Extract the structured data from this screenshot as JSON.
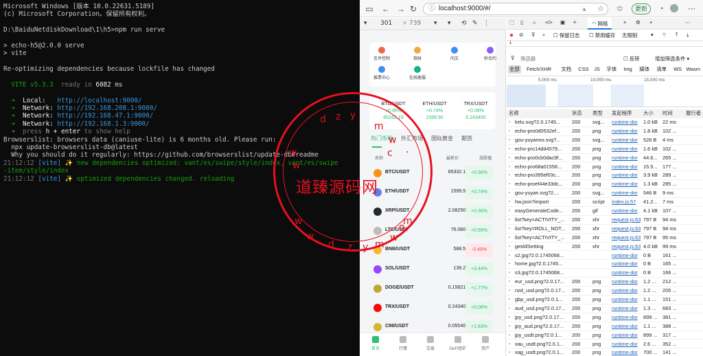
{
  "terminal": {
    "lines": [
      {
        "parts": [
          {
            "t": "Microsoft Windows [版本 10.0.22631.5189]",
            "c": ""
          }
        ]
      },
      {
        "parts": [
          {
            "t": "(c) Microsoft Corporation。保留所有权利。",
            "c": ""
          }
        ]
      },
      {
        "parts": [
          {
            "t": "",
            "c": ""
          }
        ]
      },
      {
        "parts": [
          {
            "t": "D:\\BaiduNetdiskDownload\\1\\h5>npm run serve",
            "c": ""
          }
        ]
      },
      {
        "parts": [
          {
            "t": "",
            "c": ""
          }
        ]
      },
      {
        "parts": [
          {
            "t": "> echo-h5@2.0.0 serve",
            "c": ""
          }
        ]
      },
      {
        "parts": [
          {
            "t": "> vite",
            "c": ""
          }
        ]
      },
      {
        "parts": [
          {
            "t": "",
            "c": ""
          }
        ]
      },
      {
        "parts": [
          {
            "t": "Re-optimizing dependencies because lockfile has changed",
            "c": ""
          }
        ]
      },
      {
        "parts": [
          {
            "t": "",
            "c": ""
          }
        ]
      },
      {
        "parts": [
          {
            "t": "  VITE v5.3.3",
            "c": "g"
          },
          {
            "t": "  ready in ",
            "c": "gr"
          },
          {
            "t": "6082",
            "c": "w"
          },
          {
            "t": " ms",
            "c": ""
          }
        ]
      },
      {
        "parts": [
          {
            "t": "",
            "c": ""
          }
        ]
      },
      {
        "parts": [
          {
            "t": "  ➜  ",
            "c": "g"
          },
          {
            "t": "Local:   ",
            "c": "w"
          },
          {
            "t": "http://localhost:9000/",
            "c": "c"
          }
        ]
      },
      {
        "parts": [
          {
            "t": "  ➜  ",
            "c": "g"
          },
          {
            "t": "Network: ",
            "c": "w"
          },
          {
            "t": "http://192.168.208.1:9000/",
            "c": "c"
          }
        ]
      },
      {
        "parts": [
          {
            "t": "  ➜  ",
            "c": "g"
          },
          {
            "t": "Network: ",
            "c": "w"
          },
          {
            "t": "http://192.168.47.1:9000/",
            "c": "c"
          }
        ]
      },
      {
        "parts": [
          {
            "t": "  ➜  ",
            "c": "g"
          },
          {
            "t": "Network: ",
            "c": "w"
          },
          {
            "t": "http://192.168.1.3:9000/",
            "c": "c"
          }
        ]
      },
      {
        "parts": [
          {
            "t": "  ➜  press ",
            "c": "gr"
          },
          {
            "t": "h + enter",
            "c": "w"
          },
          {
            "t": " to show help",
            "c": "gr"
          }
        ]
      },
      {
        "parts": [
          {
            "t": "Browserslist: browsers data (caniuse-lite) is 6 months old. Please run:",
            "c": ""
          }
        ]
      },
      {
        "parts": [
          {
            "t": "  npx update-browserslist-db@latest",
            "c": ""
          }
        ]
      },
      {
        "parts": [
          {
            "t": "  Why you should do it regularly: https://github.com/browserslist/update-db#readme",
            "c": ""
          }
        ]
      },
      {
        "parts": [
          {
            "t": "21:12:12 ",
            "c": "gr"
          },
          {
            "t": "[vite]",
            "c": "c"
          },
          {
            "t": " ✨ new dependencies optimized: vant/es/swipe/style/index, vant/es/swipe",
            "c": "g"
          }
        ]
      },
      {
        "parts": [
          {
            "t": "-item/style/index",
            "c": "g"
          }
        ]
      },
      {
        "parts": [
          {
            "t": "21:12:12 ",
            "c": "gr"
          },
          {
            "t": "[vite]",
            "c": "c"
          },
          {
            "t": " ✨ optimized dependencies changed. reloading",
            "c": "g"
          }
        ]
      }
    ]
  },
  "browser": {
    "url": "localhost:9000/#/",
    "update_label": "更新",
    "zoom_label": "ꭺ"
  },
  "device_toolbar": {
    "width": "301",
    "height": "739"
  },
  "quick": [
    {
      "label": "言评控制",
      "color": "#e46b4a"
    },
    {
      "label": "指财",
      "color": "#f2a93b"
    },
    {
      "label": "问文",
      "color": "#3e8ef7"
    },
    {
      "label": "秒合约",
      "color": "#8e5cf5"
    },
    {
      "label": "推票中心",
      "color": "#3e8ef7"
    },
    {
      "label": "在线客服",
      "color": "#14b28a"
    }
  ],
  "tickers": [
    {
      "pair": "BTC/USDT",
      "change": "+0.96%",
      "price": "85332.19"
    },
    {
      "pair": "ETH/USDT",
      "change": "+0.74%",
      "price": "1599.50"
    },
    {
      "pair": "TRX/USDT",
      "change": "+0.08%",
      "price": "0.243400"
    }
  ],
  "market_tabs": [
    "热门币种",
    "外汇市场",
    "国际黄金",
    "期货"
  ],
  "market_head": {
    "name": "名称",
    "price": "最新价",
    "change": "涨跌幅"
  },
  "markets": [
    {
      "name": "BTC/USDT",
      "price": "85332.19",
      "change": "+0.96%",
      "dir": "up",
      "color": "#f7931a"
    },
    {
      "name": "ETH/USDT",
      "price": "1599.50",
      "change": "+0.74%",
      "dir": "up",
      "color": "#627eea"
    },
    {
      "name": "XRP/USDT",
      "price": "2.082500",
      "change": "+0.36%",
      "dir": "up",
      "color": "#23292f"
    },
    {
      "name": "LTC/USDT",
      "price": "76.0800",
      "change": "+0.59%",
      "dir": "up",
      "color": "#bfbbbb"
    },
    {
      "name": "BNB/USDT",
      "price": "588.52",
      "change": "-0.48%",
      "dir": "down",
      "color": "#f3ba2f"
    },
    {
      "name": "SOL/USDT",
      "price": "139.25",
      "change": "+3.44%",
      "dir": "up",
      "color": "#9945ff"
    },
    {
      "name": "DOGE/USDT",
      "price": "0.158210",
      "change": "+1.77%",
      "dir": "up",
      "color": "#c2a633"
    },
    {
      "name": "TRX/USDT",
      "price": "0.243400",
      "change": "+0.08%",
      "dir": "up",
      "color": "#ff060a"
    },
    {
      "name": "C98/USDT",
      "price": "0.055400",
      "change": "+1.83%",
      "dir": "up",
      "color": "#d9b432"
    }
  ],
  "bottom_nav": [
    "首页",
    "行情",
    "交易",
    "DeFi挖矿",
    "资产"
  ],
  "devtools": {
    "tabs": [
      "网络"
    ],
    "preserve_log": "保留日志",
    "disable_cache": "禁用缓存",
    "throttle": "无限制",
    "filter_placeholder": "筛选器",
    "invert": "反转",
    "more_filters": "增加筛选条件",
    "types": [
      "全部",
      "Fetch/XHR",
      "文档",
      "CSS",
      "JS",
      "字体",
      "Img",
      "媒体",
      "清单",
      "WS",
      "Wasm",
      "其"
    ],
    "timeline": [
      "5,000 ms",
      "10,000 ms",
      "15,000 ms"
    ],
    "columns": [
      "名称",
      "状态",
      "类型",
      "发起程序",
      "大小",
      "时间",
      "履行者"
    ],
    "rows": [
      [
        "kelu.svg?2.0.1745...",
        "200",
        "svg...",
        "runtime-dor",
        "1.0 kB",
        "22 ms"
      ],
      [
        "echo-pro0d0532ef...",
        "200",
        "png",
        "runtime-dor",
        "1.8 kB",
        "102 ..."
      ],
      [
        "gou-yuyanno.svg?...",
        "200",
        "svg...",
        "runtime-dor",
        "526 B",
        "4 ms"
      ],
      [
        "echo-pro14dd4579...",
        "200",
        "png",
        "runtime-dor",
        "1.6 kB",
        "102 ..."
      ],
      [
        "echo-pro0cb0dac9f...",
        "200",
        "png",
        "runtime-dor",
        "44.6...",
        "265 ..."
      ],
      [
        "echo-pro68a01556...",
        "200",
        "png",
        "runtime-dor",
        "15.5...",
        "177 ..."
      ],
      [
        "echo-pro395ef03c...",
        "200",
        "png",
        "runtime-dor",
        "3.9 kB",
        "289 ..."
      ],
      [
        "echo-proef44e33dc...",
        "200",
        "png",
        "runtime-dor",
        "1.3 kB",
        "285 ..."
      ],
      [
        "gou-yuyan.svg?2....",
        "200",
        "svg...",
        "runtime-dor",
        "546 B",
        "9 ms"
      ],
      [
        "hw.json?import",
        "200",
        "script",
        "index.js:57",
        "41.2...",
        "7 ms"
      ],
      [
        "easyGenerateCode...",
        "200",
        "gif",
        "runtime-dor",
        "4.1 kB",
        "107 ..."
      ],
      [
        "list?key=ACTIVITY_...",
        "200",
        "xhr",
        "request.js:63",
        "797 B",
        "94 ms"
      ],
      [
        "list?key=ROLL_NOT...",
        "200",
        "xhr",
        "request.js:63",
        "797 B",
        "94 ms"
      ],
      [
        "list?key=ACTIVITY_...",
        "200",
        "xhr",
        "request.js:63",
        "797 B",
        "95 ms"
      ],
      [
        "getAllSetting",
        "200",
        "xhr",
        "request.js:63",
        "4.0 kB",
        "99 ms"
      ],
      [
        "s2.jpg?2.0.1745068...",
        "",
        "",
        "runtime-dor",
        "0 B",
        "161 ..."
      ],
      [
        "home.jpg?2.0.1745...",
        "",
        "",
        "runtime-dor",
        "0 B",
        "165 ..."
      ],
      [
        "s3.jpg?2.0.1745068...",
        "",
        "",
        "runtime-dor",
        "0 B",
        "166 ..."
      ],
      [
        "eur_usd.png?2.0.17...",
        "200",
        "png",
        "runtime-dor",
        "1.2 ...",
        "212 ..."
      ],
      [
        "nzd_usd.png?2.0.17...",
        "200",
        "png",
        "runtime-dor",
        "1.2 ...",
        "205 ..."
      ],
      [
        "gbp_usd.png?2.0.1...",
        "200",
        "png",
        "runtime-dor",
        "1.1 ...",
        "151 ..."
      ],
      [
        "aud_usd.png?2.0.17...",
        "200",
        "png",
        "runtime-dor",
        "1.3 ...",
        "683 ..."
      ],
      [
        "jpy_usd.png?2.0.17...",
        "200",
        "png",
        "runtime-dor",
        "899 ...",
        "381 ..."
      ],
      [
        "jpy_aud.png?2.0.17...",
        "200",
        "png",
        "runtime-dor",
        "1.1 ...",
        "388 ..."
      ],
      [
        "jpy_usdt.png?2.0.1...",
        "200",
        "png",
        "runtime-dor",
        "899 ...",
        "317 ..."
      ],
      [
        "xau_usdt.png?2.0.1...",
        "200",
        "png",
        "runtime-dor",
        "2.6 ...",
        "352 ..."
      ],
      [
        "xag_usdt.png?2.0.1...",
        "200",
        "png",
        "runtime-dor",
        "700 ...",
        "141 ..."
      ]
    ]
  },
  "watermark": {
    "text": "道臻源码网",
    "site": "dzymw.com",
    "color": "#e3111e"
  }
}
